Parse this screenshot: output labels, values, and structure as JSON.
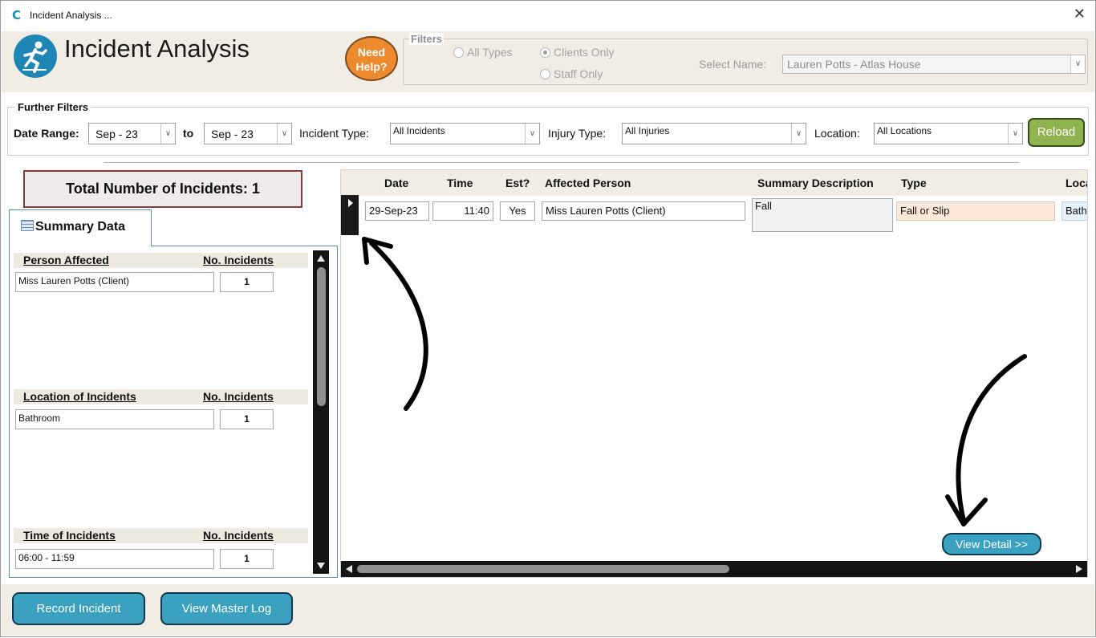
{
  "window": {
    "title": "Incident Analysis ...",
    "close_glyph": "✕",
    "logo_glyph": "C"
  },
  "header": {
    "app_title": "Incident Analysis",
    "app_icon": "person-falling-icon",
    "help_line1": "Need",
    "help_line2": "Help?",
    "filters": {
      "legend": "Filters",
      "options": [
        {
          "label": "All Types",
          "selected": false
        },
        {
          "label": "Clients Only",
          "selected": true
        },
        {
          "label": "Staff Only",
          "selected": false
        }
      ],
      "select_name_label": "Select Name:",
      "select_name_value": "Lauren Potts - Atlas House"
    }
  },
  "further_filters": {
    "legend": "Further Filters",
    "date_range_label": "Date Range:",
    "date_from": "Sep - 23",
    "to_label": "to",
    "date_to": "Sep - 23",
    "incident_type_label": "Incident Type:",
    "incident_type_value": "All Incidents",
    "injury_type_label": "Injury Type:",
    "injury_type_value": "All Injuries",
    "location_label": "Location:",
    "location_value": "All Locations",
    "reload_label": "Reload"
  },
  "summary": {
    "total_text": "Total Number of Incidents: 1",
    "tab_label": "Summary Data",
    "sections": [
      {
        "title": "Person Affected",
        "count_header": "No. Incidents",
        "name": "Miss Lauren Potts (Client)",
        "count": "1"
      },
      {
        "title": "Location of Incidents",
        "count_header": "No. Incidents",
        "name": "Bathroom",
        "count": "1"
      },
      {
        "title": "Time of Incidents",
        "count_header": "No. Incidents",
        "name": "06:00 - 11:59",
        "count": "1"
      }
    ]
  },
  "grid": {
    "columns": [
      "Date",
      "Time",
      "Est?",
      "Affected Person",
      "Summary Description",
      "Type",
      "Loca"
    ],
    "rows": [
      {
        "date": "29-Sep-23",
        "time": "11:40",
        "est": "Yes",
        "person": "Miss Lauren Potts (Client)",
        "summary": "Fall",
        "type": "Fall or Slip",
        "location": "Bath"
      }
    ],
    "view_detail_label": "View Detail >>"
  },
  "footer": {
    "record_label": "Record Incident",
    "master_log_label": "View Master Log"
  },
  "colors": {
    "header_bg": "#f1ede4",
    "accent_blue": "#3aa2c0",
    "help_orange": "#ee8a2e",
    "reload_green": "#8fb34e",
    "total_border": "#8a3a3a",
    "type_cell_bg": "#fde7d8",
    "location_cell_bg": "#e3f2fb"
  }
}
